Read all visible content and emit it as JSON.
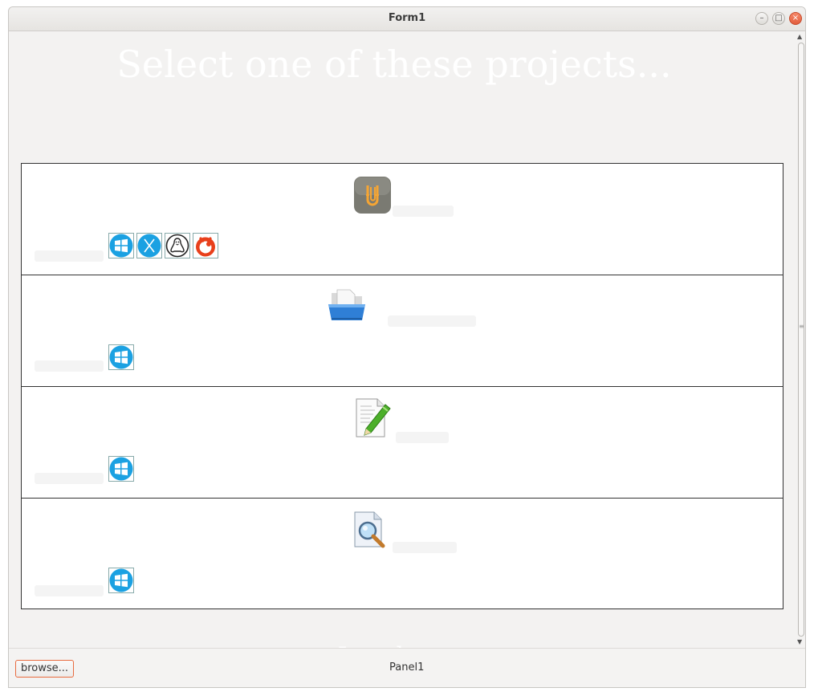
{
  "window": {
    "title": "Form1",
    "buttons": [
      {
        "name": "minimize",
        "glyph": "–"
      },
      {
        "name": "maximize",
        "glyph": "□"
      },
      {
        "name": "close",
        "glyph": "×"
      }
    ]
  },
  "main": {
    "heading": "Select one of these projects...",
    "bottom_partial_text": "Just do"
  },
  "projects": [
    {
      "icon": "castle-u-app-icon",
      "platforms": [
        "windows-icon",
        "macos-x-icon",
        "linux-tux-icon",
        "raspberry-pi-icon"
      ]
    },
    {
      "icon": "open-folder-icon",
      "platforms": [
        "windows-icon"
      ]
    },
    {
      "icon": "document-edit-icon",
      "platforms": [
        "windows-icon"
      ]
    },
    {
      "icon": "document-search-icon",
      "platforms": [
        "windows-icon"
      ]
    }
  ],
  "footer": {
    "browse_label": "browse...",
    "panel_label": "Panel1"
  },
  "colors": {
    "accent": "#e86b3f",
    "windows_blue": "#1ba1e2",
    "raspberry_red": "#e8401c"
  }
}
